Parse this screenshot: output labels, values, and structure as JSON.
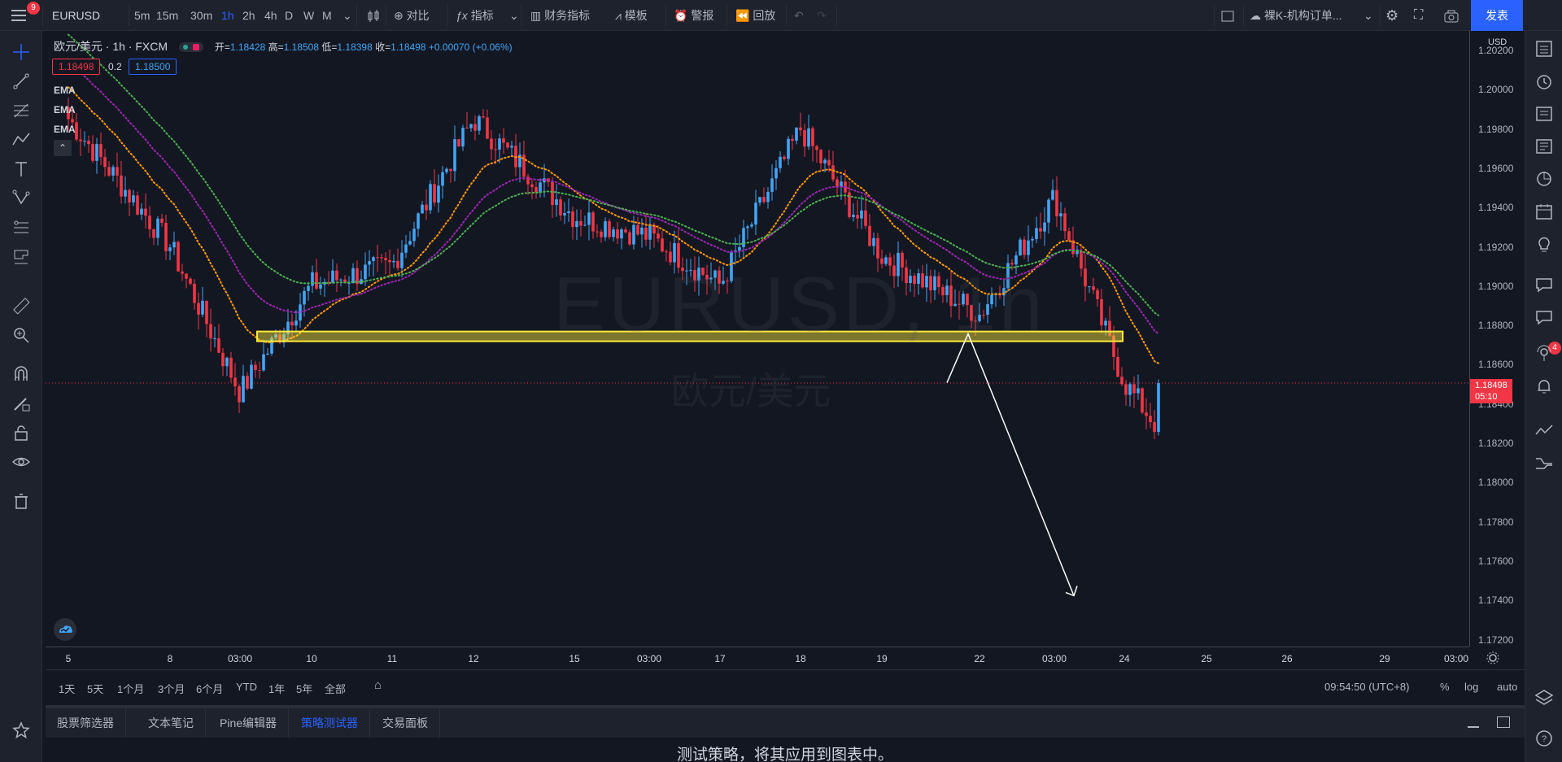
{
  "toolbar": {
    "notifications": "9",
    "symbol": "EURUSD",
    "intervals": [
      "5m",
      "15m",
      "30m",
      "1h",
      "2h",
      "4h",
      "D",
      "W",
      "M"
    ],
    "active_interval": "1h",
    "compare": "对比",
    "indicators": "指标",
    "financials": "财务指标",
    "templates": "模板",
    "alert": "警报",
    "replay": "回放",
    "layout_name": "裸K-机构订单...",
    "publish": "发表"
  },
  "legend": {
    "name": "欧元/美元",
    "interval": "1h",
    "exchange": "FXCM",
    "open_label": "开",
    "open": "1.18428",
    "high_label": "高",
    "high": "1.18508",
    "low_label": "低",
    "low": "1.18398",
    "close_label": "收",
    "close": "1.18498",
    "change": "+0.00070 (+0.06%)",
    "bid": "1.18498",
    "spread": "0.2",
    "ask": "1.18500",
    "ema_labels": [
      "EMA",
      "EMA",
      "EMA"
    ]
  },
  "watermark": {
    "symbol": "EURUSD, 1h",
    "name": "欧元/美元"
  },
  "price_scale": {
    "currency": "USD",
    "labels": [
      "1.20200",
      "1.20000",
      "1.19800",
      "1.19600",
      "1.19400",
      "1.19200",
      "1.19000",
      "1.18800",
      "1.18600",
      "1.18400",
      "1.18200",
      "1.18000",
      "1.17800",
      "1.17600",
      "1.17400",
      "1.17200"
    ],
    "last_price": "1.18498",
    "countdown": "05:10"
  },
  "time_axis": {
    "labels": [
      "5",
      "8",
      "03:00",
      "10",
      "11",
      "12",
      "15",
      "03:00",
      "17",
      "18",
      "19",
      "22",
      "03:00",
      "24",
      "25",
      "26",
      "29",
      "03:00"
    ]
  },
  "range_bar": {
    "ranges": [
      "1天",
      "5天",
      "1个月",
      "3个月",
      "6个月",
      "YTD",
      "1年",
      "5年",
      "全部"
    ],
    "clock": "09:54:50 (UTC+8)",
    "percent": "%",
    "log": "log",
    "auto": "auto"
  },
  "bottom_panel": {
    "tabs": [
      "股票筛选器",
      "文本笔记",
      "Pine编辑器",
      "策略测试器",
      "交易面板"
    ],
    "active_tab": "策略测试器",
    "message": "测试策略，将其应用到图表中。"
  },
  "colors": {
    "up": "#42a5f5",
    "down": "#f23645",
    "ema_fast": "#ff9800",
    "ema_mid": "#9c27b0",
    "ema_slow": "#4caf50",
    "zone": "#ffeb3b",
    "accent": "#2962ff"
  },
  "chart_data": {
    "type": "candlestick",
    "symbol": "EURUSD",
    "interval": "1h",
    "ylim": [
      1.1715,
      1.203
    ],
    "levels": {
      "support_zone": [
        1.18712,
        1.18762
      ],
      "last_price": 1.18498
    },
    "projection_arrow": {
      "from": 1.185,
      "peak": 1.1875,
      "target": 1.1741
    },
    "close_path": [
      {
        "x": "5",
        "y": 1.1985
      },
      {
        "x": "8",
        "y": 1.192
      },
      {
        "x": "03:00 (8)",
        "y": 1.1845
      },
      {
        "x": "10",
        "y": 1.19
      },
      {
        "x": "11",
        "y": 1.191
      },
      {
        "x": "12",
        "y": 1.1985
      },
      {
        "x": "15",
        "y": 1.1935
      },
      {
        "x": "03:00 (15)",
        "y": 1.1925
      },
      {
        "x": "17",
        "y": 1.19
      },
      {
        "x": "18",
        "y": 1.198
      },
      {
        "x": "19",
        "y": 1.1915
      },
      {
        "x": "22",
        "y": 1.1885
      },
      {
        "x": "03:00 (22)",
        "y": 1.1945
      },
      {
        "x": "24",
        "y": 1.185
      }
    ]
  }
}
